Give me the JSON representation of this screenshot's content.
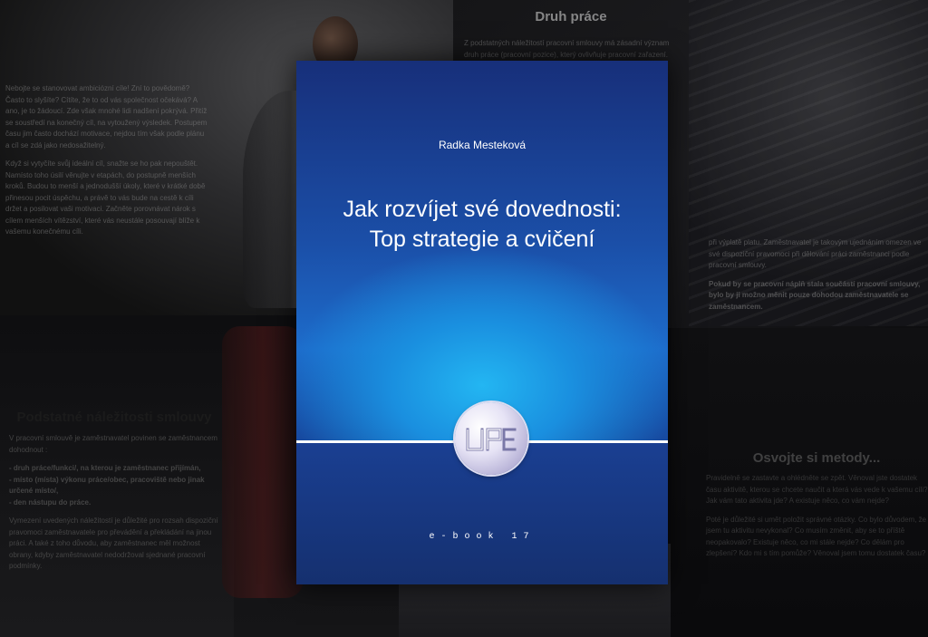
{
  "cover": {
    "author": "Radka Mesteková",
    "title_line1": "Jak rozvíjet své dovednosti:",
    "title_line2": "Top strategie a cvičení",
    "edition": "e-book 17",
    "logo_icon": "up-logo-icon"
  },
  "panel_top_left": {
    "paragraph1": "Nebojte se stanovovat ambiciózní cíle! Zní to povědomě? Často to slyšíte? Cítíte, že to od vás společnost očekává? A ano, je to žádoucí. Zde však mnohé lidi nadšení pokrývá. Přitíž se soustředí na konečný cíl, na vytoužený výsledek. Postupem času jim často dochází motivace, nejdou tím však podle plánu a cíl se zdá jako nedosažitelný.",
    "paragraph2": "Když si vytyčíte svůj ideální cíl, snažte se ho pak nepouštět. Namísto toho úsilí věnujte v etapách, do postupně menších kroků. Budou to menší a jednodušší úkoly, které v krátké době přinesou pocit úspěchu, a právě to vás bude na cestě k cíli držet a posilovat vaši motivaci. Začněte porovnávat nárok s cílem menších vítězství, které vás neustále posouvají blíže k vašemu konečnému cíli."
  },
  "panel_top_right": {
    "heading": "Druh práce",
    "paragraph1": "Z podstatných náležitostí pracovní smlouvy má zásadní význam druh práce (pracovní pozice), který ovlivňuje pracovní zařazení.",
    "paragraph2": "při výplatě platu. Zaměstnavatel je takovým ujednáním omezen ve své dispoziční pravomoci při dělování práci zaměstnanci podle pracovní smlouvy.",
    "paragraph3": "Pokud by se pracovní náplň stala součástí pracovní smlouvy, bylo by ji možno měnit pouze dohodou zaměstnavatele se zaměstnancem."
  },
  "panel_bottom_left": {
    "heading": "Podstatné náležitosti smlouvy",
    "intro": "V pracovní smlouvě je zaměstnavatel povinen se zaměstnancem dohodnout :",
    "items": [
      "- druh práce/funkci/, na kterou je zaměstnanec přijímán,",
      "- místo (místa) výkonu práce/obec, pracoviště nebo jinak určené místo/,",
      "- den nástupu do práce."
    ],
    "outro": "Vymezení uvedených náležitostí je důležité pro rozsah dispoziční pravomoci zaměstnavatele pro převádění a překládání na jinou práci. A také z toho důvodu, aby zaměstnanec měl možnost obrany, kdyby zaměstnavatel nedodržoval sjednané pracovní podmínky."
  },
  "panel_bottom_right": {
    "heading": "Osvojte si metody...",
    "paragraph1": "Pravidelně se zastavte a ohlédněte se zpět. Věnoval jste dostatek času aktivitě, kterou se chcete naučit a která vás vede k vašemu cíli? Jak vám tato aktivita jde? A existuje něco, co vám nejde?",
    "paragraph2": "Poté je důležité si umět položit správné otázky. Co bylo důvodem, že jsem tu aktivitu nevykonal? Co musím změnit, aby se to příště neopakovalo? Existuje něco, co mi stále nejde? Co dělám pro zlepšení? Kdo mi s tím pomůže? Věnoval jsem tomu dostatek času?"
  }
}
